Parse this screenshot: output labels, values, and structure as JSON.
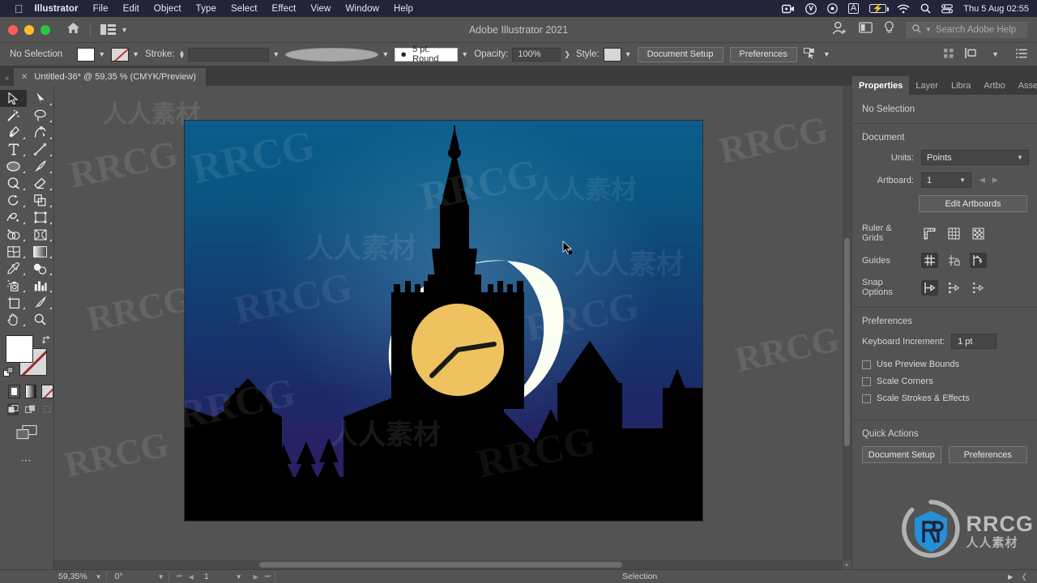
{
  "macos_menubar": {
    "apple_icon": "apple-icon",
    "items": [
      {
        "label": "Illustrator",
        "bold": true
      },
      {
        "label": "File",
        "bold": false
      },
      {
        "label": "Edit",
        "bold": false
      },
      {
        "label": "Object",
        "bold": false
      },
      {
        "label": "Type",
        "bold": false
      },
      {
        "label": "Select",
        "bold": false
      },
      {
        "label": "Effect",
        "bold": false
      },
      {
        "label": "View",
        "bold": false
      },
      {
        "label": "Window",
        "bold": false
      },
      {
        "label": "Help",
        "bold": false
      }
    ],
    "status_icons": [
      "screen-record-icon",
      "mic-icon",
      "play-circle-icon",
      "input-source-icon",
      "battery-charging-icon",
      "wifi-icon",
      "spotlight-search-icon",
      "control-center-icon"
    ],
    "input_source_label": "A",
    "datetime": "Thu 5 Aug  02:55"
  },
  "titlebar": {
    "window_title": "Adobe Illustrator 2021",
    "home_icon": "home-icon",
    "layout_icon": "workspace-layout-icon",
    "account_icon": "user-account-icon",
    "share_icon": "share-document-icon",
    "help_bulb_icon": "lightbulb-icon",
    "search_icon": "search-icon",
    "search_placeholder": "Search Adobe Help"
  },
  "control_bar": {
    "selection_status": "No Selection",
    "fill_label": "fill-swatch",
    "stroke_swatch_label": "stroke-swatch-none",
    "stroke_label": "Stroke:",
    "stroke_weight_value": "",
    "stroke_profile_value": "",
    "brush_definition": "5 pt. Round",
    "opacity_label": "Opacity:",
    "opacity_value": "100%",
    "style_label": "Style:",
    "document_setup_button": "Document Setup",
    "preferences_button": "Preferences",
    "select_similar_icon": "select-similar-icon",
    "align_icon": "align-icon",
    "more_options_icon": "options-menu-icon"
  },
  "document_tab": {
    "close_icon": "close-tab-icon",
    "title": "Untitled-36* @ 59,35 % (CMYK/Preview)"
  },
  "toolbar": {
    "collapse_icon": "collapse-panel-icon",
    "tools": [
      {
        "name": "selection-tool",
        "selected": true
      },
      {
        "name": "direct-selection-tool",
        "selected": false
      },
      {
        "name": "magic-wand-tool",
        "selected": false
      },
      {
        "name": "lasso-tool",
        "selected": false
      },
      {
        "name": "pen-tool",
        "selected": false
      },
      {
        "name": "curvature-tool",
        "selected": false
      },
      {
        "name": "type-tool",
        "selected": false
      },
      {
        "name": "line-segment-tool",
        "selected": false
      },
      {
        "name": "ellipse-tool",
        "selected": false
      },
      {
        "name": "paintbrush-tool",
        "selected": false
      },
      {
        "name": "shaper-tool",
        "selected": false
      },
      {
        "name": "eraser-tool",
        "selected": false
      },
      {
        "name": "rotate-tool",
        "selected": false
      },
      {
        "name": "scale-tool",
        "selected": false
      },
      {
        "name": "width-tool",
        "selected": false
      },
      {
        "name": "free-transform-tool",
        "selected": false
      },
      {
        "name": "shape-builder-tool",
        "selected": false
      },
      {
        "name": "perspective-grid-tool",
        "selected": false
      },
      {
        "name": "mesh-tool",
        "selected": false
      },
      {
        "name": "gradient-tool",
        "selected": false
      },
      {
        "name": "eyedropper-tool",
        "selected": false
      },
      {
        "name": "blend-tool",
        "selected": false
      },
      {
        "name": "symbol-sprayer-tool",
        "selected": false
      },
      {
        "name": "column-graph-tool",
        "selected": false
      },
      {
        "name": "artboard-tool",
        "selected": false
      },
      {
        "name": "slice-tool",
        "selected": false
      },
      {
        "name": "hand-tool",
        "selected": false
      },
      {
        "name": "zoom-tool",
        "selected": false
      }
    ],
    "fill_color": "#ffffff",
    "stroke_color": "none",
    "swap_icon": "swap-fill-stroke-icon",
    "default_icon": "default-fill-stroke-icon",
    "color_modes": [
      "color-swatch-mode",
      "gradient-mode",
      "none-mode"
    ],
    "draw_modes": [
      "draw-normal-mode",
      "draw-behind-mode",
      "draw-inside-mode"
    ],
    "screen_mode_icon": "change-screen-mode-icon",
    "overflow_icon": "edit-toolbar-icon"
  },
  "properties_panel": {
    "tabs": [
      {
        "label": "Properties",
        "active": true
      },
      {
        "label": "Layer",
        "active": false
      },
      {
        "label": "Libra",
        "active": false
      },
      {
        "label": "Artbo",
        "active": false
      },
      {
        "label": "Asset",
        "active": false
      }
    ],
    "selection_status": "No Selection",
    "document_section": {
      "heading": "Document",
      "units_label": "Units:",
      "units_value": "Points",
      "artboard_label": "Artboard:",
      "artboard_value": "1",
      "prev_icon": "previous-artboard-icon",
      "next_icon": "next-artboard-icon",
      "edit_artboards_button": "Edit Artboards"
    },
    "ruler_grids": {
      "label": "Ruler & Grids",
      "icons": [
        "show-rulers-icon",
        "show-grid-icon",
        "show-transparency-grid-icon"
      ]
    },
    "guides": {
      "label": "Guides",
      "icons": [
        "show-guides-icon",
        "lock-guides-icon",
        "smart-guides-icon"
      ],
      "active": [
        true,
        false,
        true
      ]
    },
    "snap_options": {
      "label": "Snap Options",
      "icons": [
        "snap-to-point-icon",
        "snap-to-grid-icon",
        "snap-to-pixel-icon"
      ],
      "active": [
        true,
        false,
        false
      ]
    },
    "preferences_section": {
      "heading": "Preferences",
      "keyboard_increment_label": "Keyboard Increment:",
      "keyboard_increment_value": "1 pt",
      "checkboxes": [
        {
          "label": "Use Preview Bounds",
          "checked": false
        },
        {
          "label": "Scale Corners",
          "checked": false
        },
        {
          "label": "Scale Strokes & Effects",
          "checked": false
        }
      ]
    },
    "quick_actions": {
      "heading": "Quick Actions",
      "buttons": [
        "Document Setup",
        "Preferences"
      ]
    }
  },
  "status_bar": {
    "zoom_value": "59,35%",
    "rotation_value": "0°",
    "artboard_value": "1",
    "first_icon": "first-artboard-icon",
    "prev_icon": "previous-artboard-icon",
    "next_icon": "next-artboard-icon",
    "last_icon": "last-artboard-icon",
    "tool_status": "Selection",
    "play_icon": "status-menu-icon",
    "expand_icon": "expand-status-icon"
  },
  "artwork": {
    "description": "Night cityscape with crescent moon and clock tower",
    "sky_gradient_top": "#0b5b86",
    "sky_gradient_mid": "#123a6e",
    "sky_gradient_bottom": "#2b1d63",
    "moon_color": "#fbfff2",
    "silhouette_color": "#000000",
    "clock_face_color": "#edc25f",
    "cursor_icon": "selection-cursor"
  },
  "watermarks": {
    "brand_text": "RRCG",
    "brand_subtext": "人人素材",
    "tiles": [
      "RRCG",
      "人人素材"
    ]
  }
}
